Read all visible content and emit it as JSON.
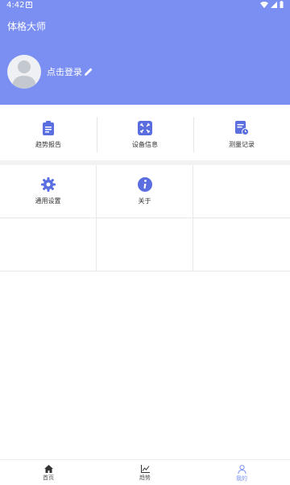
{
  "status": {
    "time": "4:42",
    "notif_glyph": "A"
  },
  "header": {
    "title": "体格大师",
    "login_text": "点击登录"
  },
  "menu_row1": [
    {
      "label": "趋势报告",
      "icon": "report-icon"
    },
    {
      "label": "设备信息",
      "icon": "device-icon"
    },
    {
      "label": "测量记录",
      "icon": "record-icon"
    }
  ],
  "menu_grid": [
    {
      "label": "通用设置",
      "icon": "gear-icon"
    },
    {
      "label": "关于",
      "icon": "info-icon"
    }
  ],
  "bottom_nav": [
    {
      "label": "首页",
      "icon": "home-icon",
      "active": false
    },
    {
      "label": "趋势",
      "icon": "trend-icon",
      "active": false
    },
    {
      "label": "我的",
      "icon": "profile-icon",
      "active": true
    }
  ],
  "colors": {
    "primary": "#7b8ff3",
    "text": "#333333",
    "divider": "#e8e8e8"
  }
}
